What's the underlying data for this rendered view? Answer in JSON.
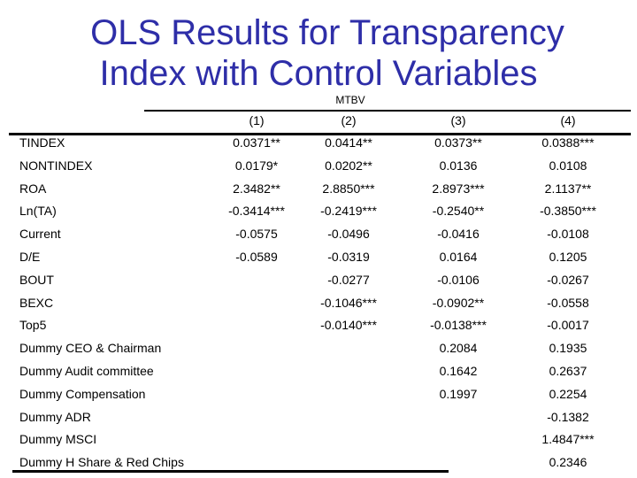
{
  "title": {
    "line1": "OLS Results for Transparency",
    "line2": "Index with Control Variables"
  },
  "table": {
    "group_label": "MTBV",
    "columns": [
      "(1)",
      "(2)",
      "(3)",
      "(4)"
    ],
    "rows": [
      {
        "label": "TINDEX",
        "values": [
          "0.0371**",
          "0.0414**",
          "0.0373**",
          "0.0388***"
        ]
      },
      {
        "label": "NONTINDEX",
        "values": [
          "0.0179*",
          "0.0202**",
          "0.0136",
          "0.0108"
        ]
      },
      {
        "label": "ROA",
        "values": [
          "2.3482**",
          "2.8850***",
          "2.8973***",
          "2.1137**"
        ]
      },
      {
        "label": "Ln(TA)",
        "values": [
          "-0.3414***",
          "-0.2419***",
          "-0.2540**",
          "-0.3850***"
        ]
      },
      {
        "label": "Current",
        "values": [
          "-0.0575",
          "-0.0496",
          "-0.0416",
          "-0.0108"
        ]
      },
      {
        "label": "D/E",
        "values": [
          "-0.0589",
          "-0.0319",
          "0.0164",
          "0.1205"
        ]
      },
      {
        "label": "BOUT",
        "values": [
          "",
          "-0.0277",
          "-0.0106",
          "-0.0267"
        ]
      },
      {
        "label": "BEXC",
        "values": [
          "",
          "-0.1046***",
          "-0.0902**",
          "-0.0558"
        ]
      },
      {
        "label": "Top5",
        "values": [
          "",
          "-0.0140***",
          "-0.0138***",
          "-0.0017"
        ]
      },
      {
        "label": "Dummy CEO & Chairman",
        "values": [
          "",
          "",
          "0.2084",
          "0.1935"
        ]
      },
      {
        "label": "Dummy Audit committee",
        "values": [
          "",
          "",
          "0.1642",
          "0.2637"
        ]
      },
      {
        "label": "Dummy Compensation",
        "values": [
          "",
          "",
          "0.1997",
          "0.2254"
        ]
      },
      {
        "label": "Dummy ADR",
        "values": [
          "",
          "",
          "",
          "-0.1382"
        ]
      },
      {
        "label": "Dummy MSCI",
        "values": [
          "",
          "",
          "",
          "1.4847***"
        ]
      },
      {
        "label": "Dummy H Share & Red Chips",
        "values": [
          "",
          "",
          "",
          "0.2346"
        ]
      }
    ]
  }
}
